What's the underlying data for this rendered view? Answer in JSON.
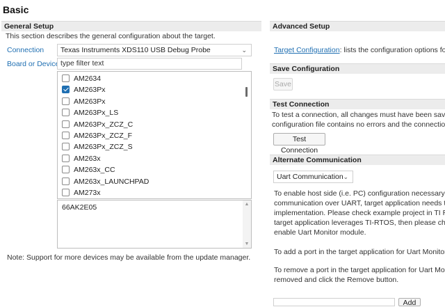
{
  "page": {
    "title": "Basic"
  },
  "general": {
    "header": "General Setup",
    "description": "This section describes the general configuration about the target.",
    "connection_label": "Connection",
    "connection_value": "Texas Instruments XDS110 USB Debug Probe",
    "board_label": "Board or Device",
    "filter_text": "type filter text",
    "devices": [
      {
        "label": "AM2634",
        "checked": false
      },
      {
        "label": "AM263Px",
        "checked": true
      },
      {
        "label": "AM263Px",
        "checked": false
      },
      {
        "label": "AM263Px_LS",
        "checked": false
      },
      {
        "label": "AM263Px_ZCZ_C",
        "checked": false
      },
      {
        "label": "AM263Px_ZCZ_F",
        "checked": false
      },
      {
        "label": "AM263Px_ZCZ_S",
        "checked": false
      },
      {
        "label": "AM263x",
        "checked": false
      },
      {
        "label": "AM263x_CC",
        "checked": false
      },
      {
        "label": "AM263x_LAUNCHPAD",
        "checked": false
      },
      {
        "label": "AM273x",
        "checked": false
      }
    ],
    "details_text": "66AK2E05",
    "note": "Note: Support for more devices may be available from the update manager."
  },
  "advanced": {
    "header": "Advanced Setup",
    "link_text": "Target Configuration",
    "link_rest": ": lists the configuration options for"
  },
  "save": {
    "header": "Save Configuration",
    "button": "Save"
  },
  "test": {
    "header": "Test Connection",
    "line1": "To test a connection, all changes must have been saved,",
    "line2": "configuration file contains no errors and the connection",
    "button": "Test Connection"
  },
  "alternate": {
    "header": "Alternate Communication",
    "dropdown_value": "Uart Communication",
    "para1": [
      "To enable host side (i.e. PC) configuration necessary to f",
      "communication over UART, target application needs to i",
      "implementation. Please check example project in TI Resc",
      "target application leverages TI-RTOS, then please check",
      "enable Uart Monitor module."
    ],
    "para2": "To add a port in the target application for Uart Monitor,",
    "para3": [
      "To remove a port in the target application for Uart Moni",
      "removed and click the Remove button."
    ],
    "add_button": "Add"
  }
}
